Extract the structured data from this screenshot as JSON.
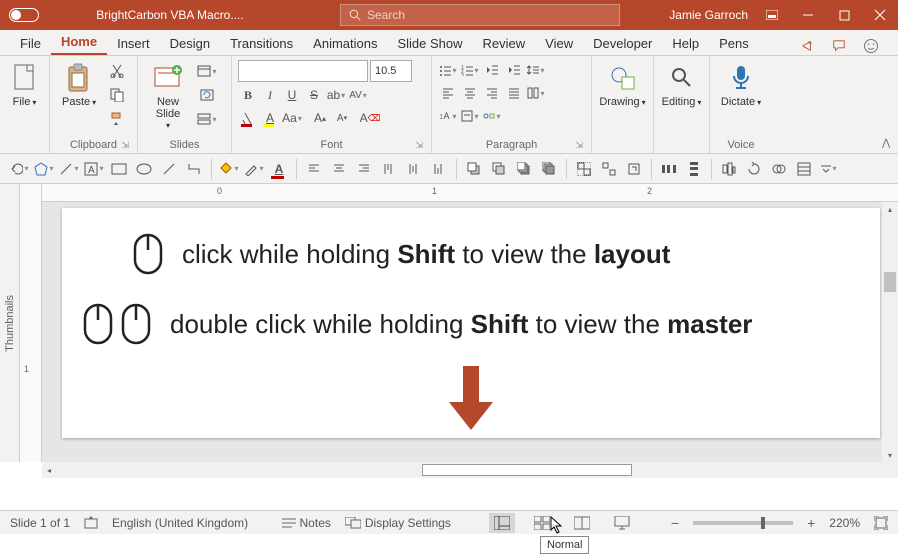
{
  "titlebar": {
    "doc_title": "BrightCarbon VBA Macro....",
    "search_placeholder": "Search",
    "user": "Jamie Garroch"
  },
  "tabs": {
    "file": "File",
    "home": "Home",
    "insert": "Insert",
    "design": "Design",
    "transitions": "Transitions",
    "animations": "Animations",
    "slideshow": "Slide Show",
    "review": "Review",
    "view": "View",
    "developer": "Developer",
    "help": "Help",
    "pens": "Pens"
  },
  "ribbon": {
    "file": "File",
    "paste": "Paste",
    "clipboard": "Clipboard",
    "new_slide": "New Slide",
    "slides": "Slides",
    "font_size": "10.5",
    "font_group": "Font",
    "paragraph": "Paragraph",
    "drawing": "Drawing",
    "editing": "Editing",
    "dictate": "Dictate",
    "voice": "Voice"
  },
  "slide": {
    "line1_pre": "click while holding ",
    "line1_b1": "Shift",
    "line1_mid": " to view the ",
    "line1_b2": "layout",
    "line2_pre": "double click while holding ",
    "line2_b1": "Shift",
    "line2_mid": " to view the ",
    "line2_b2": "master"
  },
  "ruler": {
    "n0": "0",
    "n1": "1",
    "n2": "2",
    "v1": "1"
  },
  "thumbnails_label": "Thumbnails",
  "status": {
    "slide_info": "Slide 1 of 1",
    "language": "English (United Kingdom)",
    "notes": "Notes",
    "display": "Display Settings",
    "zoom": "220%"
  },
  "tooltip": "Normal"
}
